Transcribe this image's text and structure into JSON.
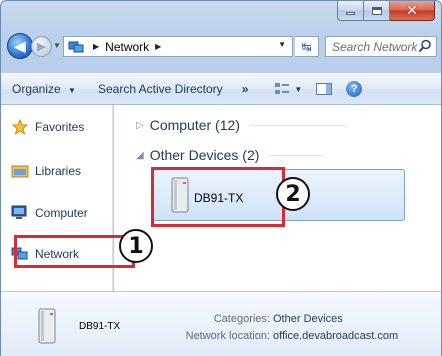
{
  "window": {
    "caption": {
      "minimize": "minimize-icon",
      "maximize": "maximize-icon",
      "close": "close-icon"
    }
  },
  "address_bar": {
    "location": "Network",
    "search_placeholder": "Search Network"
  },
  "toolbar": {
    "organize": "Organize",
    "search_ad": "Search Active Directory",
    "more": "»"
  },
  "nav_pane": {
    "items": [
      {
        "label": "Favorites",
        "icon": "star-icon"
      },
      {
        "label": "Libraries",
        "icon": "libraries-icon"
      },
      {
        "label": "Computer",
        "icon": "computer-icon"
      },
      {
        "label": "Network",
        "icon": "network-icon"
      }
    ]
  },
  "content": {
    "groups": [
      {
        "label": "Computer (12)",
        "expanded": false
      },
      {
        "label": "Other Devices (2)",
        "expanded": true
      }
    ],
    "device": {
      "name": "DB91-TX",
      "icon": "device-icon"
    }
  },
  "callouts": {
    "one": "1",
    "two": "2",
    "color": "#d92b33"
  },
  "details": {
    "name": "DB91-TX",
    "categories_label": "Categories:",
    "categories_value": "Other Devices",
    "location_label": "Network location:",
    "location_value": "office.devabroadcast.com"
  }
}
